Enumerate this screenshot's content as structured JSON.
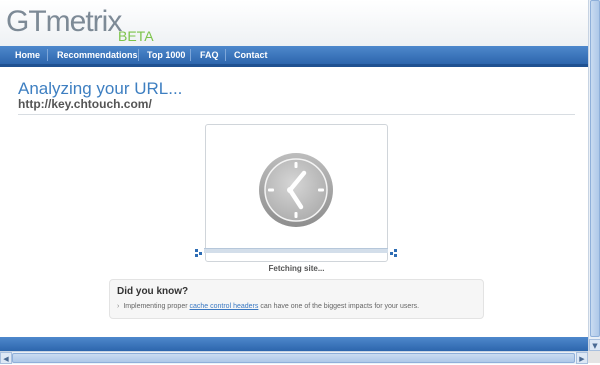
{
  "logo": {
    "main": "GTmetrix",
    "badge": "BETA"
  },
  "nav": {
    "items": [
      {
        "label": "Home"
      },
      {
        "label": "Recommendations"
      },
      {
        "label": "Top 1000"
      },
      {
        "label": "FAQ"
      },
      {
        "label": "Contact"
      }
    ]
  },
  "main": {
    "title": "Analyzing your URL...",
    "url": "http://key.chtouch.com/",
    "status": "Fetching site...",
    "icon": "clock-icon"
  },
  "tip": {
    "title": "Did you know?",
    "bullet": "›",
    "before": "Implementing proper",
    "link": "cache control headers",
    "after": "can have one of the biggest impacts for your users."
  },
  "scrollbars": {
    "up": "▲",
    "down": "▼",
    "left": "◀",
    "right": "▶"
  },
  "colors": {
    "brand_blue": "#3e7fc1",
    "nav_blue": "#2d66ad",
    "beta_green": "#7cc34a"
  }
}
